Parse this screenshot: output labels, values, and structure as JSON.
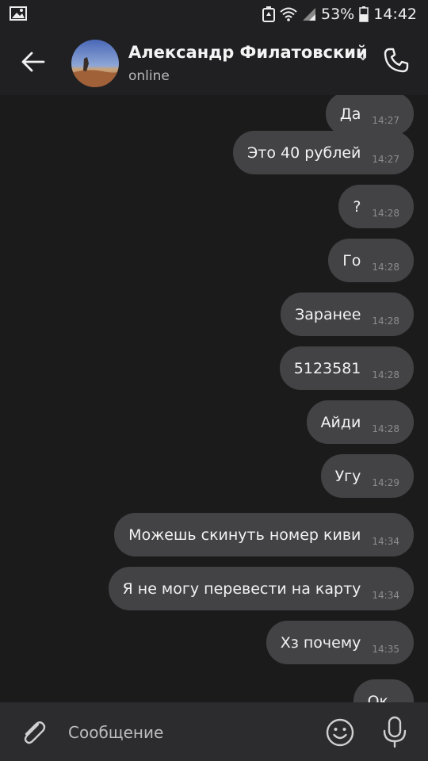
{
  "status_bar": {
    "battery": "53%",
    "time": "14:42",
    "icons": [
      "image-icon",
      "recycle-icon",
      "wifi-icon",
      "signal-icon",
      "battery-icon"
    ]
  },
  "header": {
    "contact_name": "Александр Филатовский",
    "status": "online",
    "icons": [
      "back-arrow-icon",
      "chevron-down-icon",
      "phone-icon"
    ]
  },
  "messages": [
    {
      "text": "Да",
      "time": "14:27"
    },
    {
      "text": "Это 40 рублей",
      "time": "14:27"
    },
    {
      "text": "?",
      "time": "14:28"
    },
    {
      "text": "Го",
      "time": "14:28"
    },
    {
      "text": "Заранее",
      "time": "14:28"
    },
    {
      "text": "5123581",
      "time": "14:28"
    },
    {
      "text": "Айди",
      "time": "14:28"
    },
    {
      "text": "Угу",
      "time": "14:29"
    },
    {
      "text": "Можешь скинуть номер киви",
      "time": "14:34"
    },
    {
      "text": "Я не могу перевести на карту",
      "time": "14:34"
    },
    {
      "text": "Хз почему",
      "time": "14:35"
    },
    {
      "text": "Ок",
      "time": ""
    }
  ],
  "composer": {
    "placeholder": "Сообщение",
    "icons": [
      "paperclip-icon",
      "smiley-icon",
      "microphone-icon"
    ]
  },
  "colors": {
    "background": "#1b1b1c",
    "header": "#202022",
    "bubble": "#434345",
    "composer": "#2c2c2e"
  }
}
